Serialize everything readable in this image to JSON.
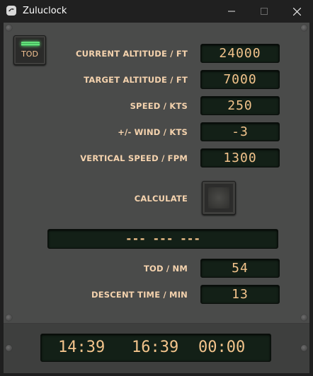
{
  "window": {
    "title": "Zuluclock",
    "icon": "zuluclock-app-icon",
    "controls": [
      "minimize-icon",
      "maximize-icon",
      "close-icon"
    ]
  },
  "tod_button": {
    "label": "TOD",
    "led_color": "#63e27a"
  },
  "fields": [
    {
      "label": "CURRENT ALTITUDE / FT",
      "value": "24000"
    },
    {
      "label": "TARGET ALTITUDE / FT",
      "value": "7000"
    },
    {
      "label": "SPEED / KTS",
      "value": "250"
    },
    {
      "label": "+/- WIND / KTS",
      "value": "-3"
    },
    {
      "label": "VERTICAL SPEED / FPM",
      "value": "1300"
    }
  ],
  "calculate": {
    "label": "CALCULATE"
  },
  "result": {
    "text": "--- --- ---"
  },
  "outputs": [
    {
      "label": "TOD / NM",
      "value": "54"
    },
    {
      "label": "DESCENT TIME / MIN",
      "value": "13"
    }
  ],
  "clocks": [
    "14:39",
    "16:39",
    "00:00"
  ],
  "colors": {
    "panel": "#4a4b4a",
    "display_bg": "#132017",
    "display_text": "#f3c48c",
    "label_text": "#f5d3ae"
  }
}
